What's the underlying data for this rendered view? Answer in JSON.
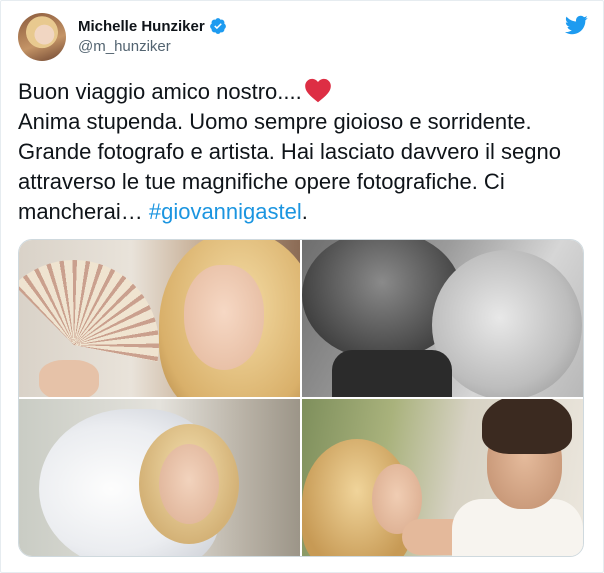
{
  "tweet": {
    "author": {
      "display_name": "Michelle Hunziker",
      "handle": "@m_hunziker",
      "verified": true,
      "avatar_icon": "profile-photo"
    },
    "brand_icon": "twitter-bird-icon",
    "brand_color": "#1d9bf0",
    "text": {
      "line1": "Buon viaggio amico nostro....",
      "line1_emoji": "red-heart",
      "body": "Anima stupenda. Uomo sempre gioioso e sorridente.\nGrande fotografo e artista. Hai lasciato davvero il segno\nattraverso le tue magnifiche opere fotografiche. Ci\nmancherai… ",
      "hashtag": "#giovannigastel",
      "trailing": "."
    },
    "hashtag_color": "#1b95e0",
    "media": [
      {
        "kind": "photo",
        "subject": "woman-with-fan"
      },
      {
        "kind": "photo",
        "subject": "black-and-white-couple"
      },
      {
        "kind": "photo",
        "subject": "woman-with-feathers"
      },
      {
        "kind": "photo",
        "subject": "couple-in-garden"
      }
    ]
  }
}
